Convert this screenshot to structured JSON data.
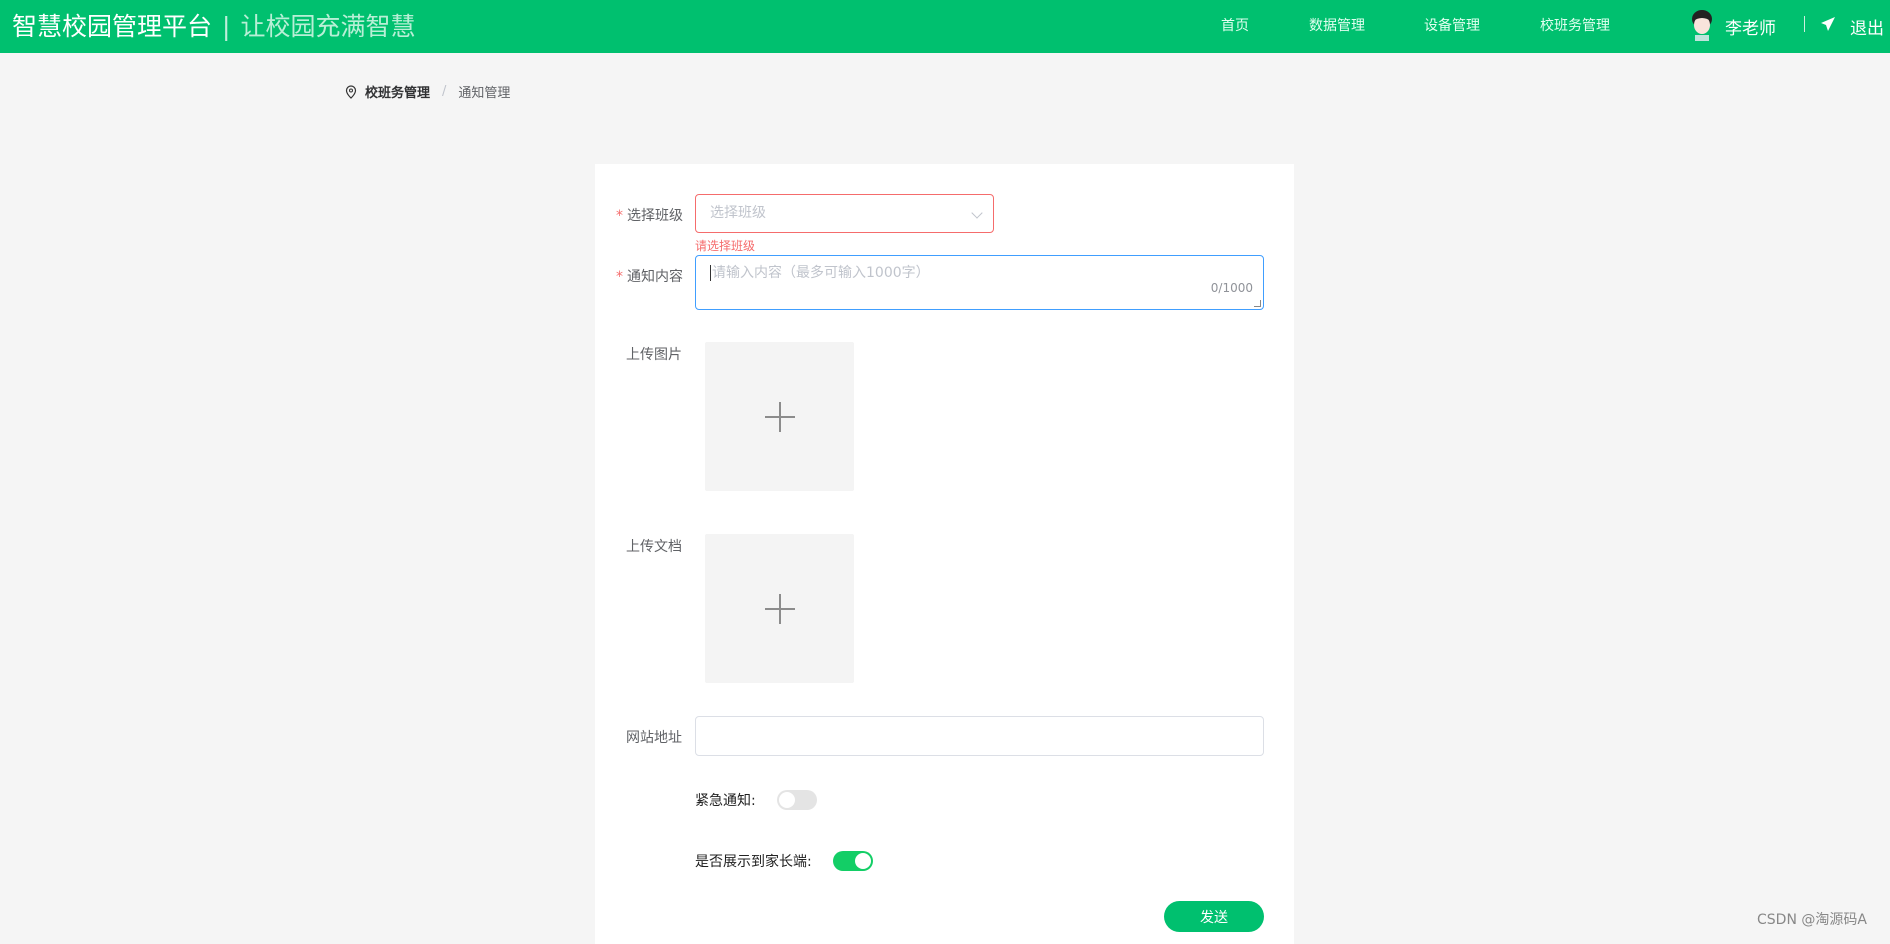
{
  "header": {
    "title": "智慧校园管理平台",
    "separator": "|",
    "slogan": "让校园充满智慧",
    "nav": [
      {
        "label": "首页"
      },
      {
        "label": "数据管理"
      },
      {
        "label": "设备管理"
      },
      {
        "label": "校班务管理"
      }
    ],
    "user": "李老师",
    "logout": "退出",
    "brand_color": "#00c06f"
  },
  "breadcrumb": {
    "items": [
      "校班务管理",
      "通知管理"
    ],
    "separator": "/"
  },
  "form": {
    "class_label": "选择班级",
    "class_placeholder": "选择班级",
    "class_error": "请选择班级",
    "content_label": "通知内容",
    "content_placeholder": "请输入内容（最多可输入1000字）",
    "content_count": "0/1000",
    "image_label": "上传图片",
    "doc_label": "上传文档",
    "url_label": "网站地址",
    "url_value": "",
    "urgent_label": "紧急通知:",
    "urgent_on": false,
    "parent_label": "是否展示到家长端:",
    "parent_on": true,
    "submit": "发送",
    "required_mark": "*"
  },
  "watermark": "CSDN @淘源码A"
}
